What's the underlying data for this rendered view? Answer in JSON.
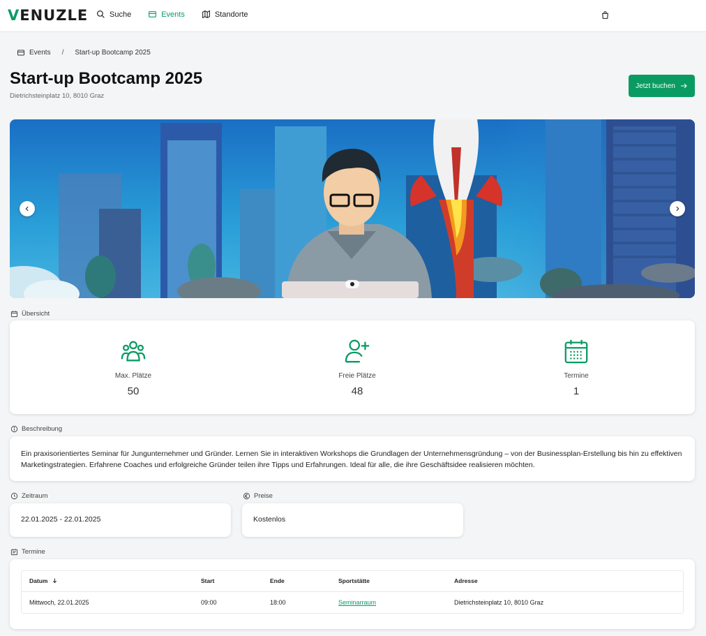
{
  "header": {
    "logo": "VENUZLE",
    "nav": [
      {
        "label": "Suche",
        "icon": "search-icon"
      },
      {
        "label": "Events",
        "icon": "ticket-icon"
      },
      {
        "label": "Standorte",
        "icon": "map-icon"
      }
    ],
    "cart_icon": "shopping-bag-icon"
  },
  "breadcrumb": {
    "parent": "Events",
    "separator": "/",
    "current": "Start-up Bootcamp 2025"
  },
  "event": {
    "title": "Start-up Bootcamp 2025",
    "address": "Dietrichsteinplatz 10, 8010 Graz",
    "book_label": "Jetzt buchen"
  },
  "overview": {
    "label": "Übersicht",
    "stats": [
      {
        "label": "Max. Plätze",
        "value": "50",
        "icon": "users-group-icon"
      },
      {
        "label": "Freie Plätze",
        "value": "48",
        "icon": "user-plus-icon"
      },
      {
        "label": "Termine",
        "value": "1",
        "icon": "calendar-icon"
      }
    ]
  },
  "description": {
    "label": "Beschreibung",
    "text": "Ein praxisorientiertes Seminar für Jungunternehmer und Gründer. Lernen Sie in interaktiven Workshops die Grundlagen der Unternehmensgründung – von der Businessplan-Erstellung bis hin zu effektiven Marketingstrategien. Erfahrene Coaches und erfolgreiche Gründer teilen ihre Tipps und Erfahrungen. Ideal für alle, die ihre Geschäftsidee realisieren möchten."
  },
  "period": {
    "label": "Zeitraum",
    "value": "22.01.2025 - 22.01.2025"
  },
  "prices": {
    "label": "Preise",
    "value": "Kostenlos"
  },
  "schedule": {
    "label": "Termine",
    "columns": [
      "Datum",
      "Start",
      "Ende",
      "Sportstätte",
      "Adresse"
    ],
    "rows": [
      {
        "date": "Mittwoch, 22.01.2025",
        "start": "09:00",
        "end": "18:00",
        "venue": "Seminarraum",
        "address": "Dietrichsteinplatz 10, 8010 Graz"
      }
    ]
  },
  "colors": {
    "accent": "#0a9b63",
    "background": "#f4f5f6"
  }
}
